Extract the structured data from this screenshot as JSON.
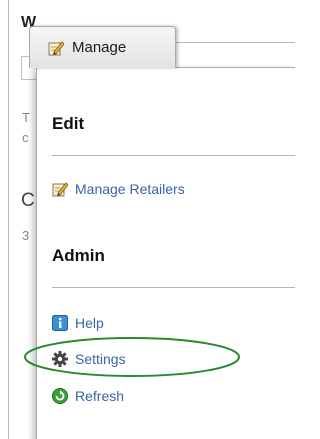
{
  "background": {
    "heading": "W",
    "line1": "T",
    "line2": "c",
    "big_letter": "C",
    "small_digit": "3"
  },
  "manage_tab": {
    "label": "Manage",
    "icon": "pencil-icon"
  },
  "menu": {
    "edit_title": "Edit",
    "edit_items": [
      {
        "label": "Manage Retailers",
        "icon": "pencil-icon"
      }
    ],
    "admin_title": "Admin",
    "admin_items": [
      {
        "label": "Help",
        "icon": "help-icon"
      },
      {
        "label": "Settings",
        "icon": "gear-icon"
      },
      {
        "label": "Refresh",
        "icon": "refresh-icon"
      }
    ]
  },
  "colors": {
    "link": "#3a63a8",
    "highlight": "#2b8a2b"
  }
}
